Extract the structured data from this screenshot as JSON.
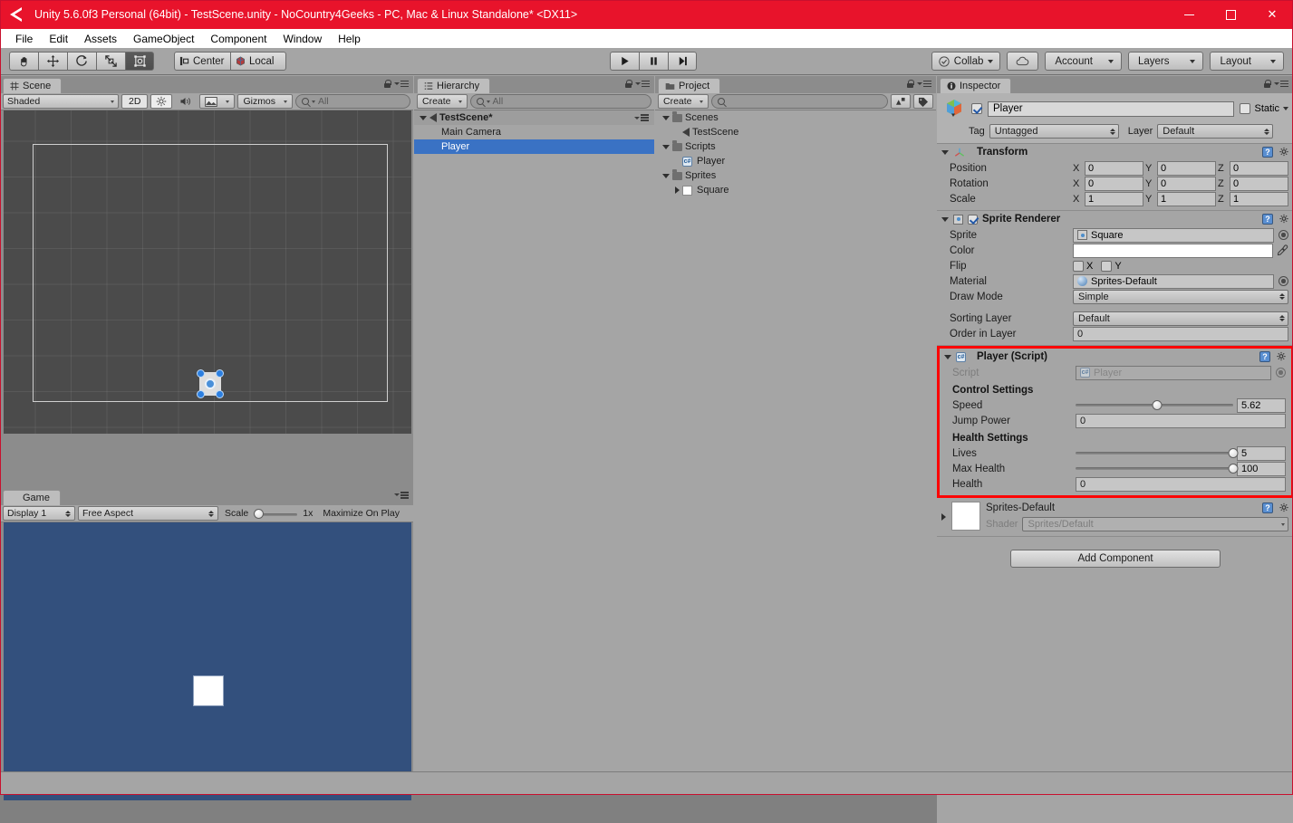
{
  "window": {
    "title": "Unity 5.6.0f3 Personal (64bit) - TestScene.unity - NoCountry4Geeks - PC, Mac & Linux Standalone* <DX11>",
    "title_icon": "unity-logo-icon",
    "minimize": "—",
    "maximize": "□",
    "close": "✕",
    "titlebar_color": "#e8132b"
  },
  "menu": {
    "items": [
      "File",
      "Edit",
      "Assets",
      "GameObject",
      "Component",
      "Window",
      "Help"
    ]
  },
  "toolbar": {
    "tools": [
      {
        "name": "hand-tool",
        "icon": "hand-icon",
        "active": false
      },
      {
        "name": "move-tool",
        "icon": "move-arrows-icon",
        "active": false
      },
      {
        "name": "rotate-tool",
        "icon": "rotate-icon",
        "active": false
      },
      {
        "name": "scale-tool",
        "icon": "scale-icon",
        "active": false
      },
      {
        "name": "rect-tool",
        "icon": "rect-transform-icon",
        "active": true
      }
    ],
    "pivot_mode": "Center",
    "pivot_rotation": "Local",
    "play": "play-icon",
    "pause": "pause-icon",
    "step": "step-icon",
    "collab": "Collab",
    "cloud": "cloud-icon",
    "account": "Account",
    "layers": "Layers",
    "layout": "Layout"
  },
  "scene_panel": {
    "tab": "Scene",
    "tab_icon": "scene-grid-icon",
    "shading_mode": "Shaded",
    "mode_2d": "2D",
    "lighting_icon": "sun-icon",
    "audio_icon": "speaker-icon",
    "effects_icon": "image-icon",
    "gizmos": "Gizmos",
    "search_placeholder": "All"
  },
  "game_panel": {
    "tab": "Game",
    "tab_icon": "game-controller-icon",
    "display": "Display 1",
    "aspect": "Free Aspect",
    "scale_label": "Scale",
    "scale_value": "1x",
    "maximize_on_play": "Maximize On Play",
    "background_color": "#33507d"
  },
  "hierarchy_panel": {
    "tab": "Hierarchy",
    "tab_icon": "hierarchy-list-icon",
    "create_button": "Create",
    "search_placeholder": "All",
    "items": [
      {
        "label": "TestScene*",
        "icon": "unity-scene-icon",
        "depth": 0,
        "expanded": true,
        "selected": false
      },
      {
        "label": "Main Camera",
        "icon": "",
        "depth": 1,
        "expanded": false,
        "selected": false
      },
      {
        "label": "Player",
        "icon": "",
        "depth": 1,
        "expanded": false,
        "selected": true
      }
    ]
  },
  "project_panel": {
    "tab": "Project",
    "tab_icon": "folder-icon",
    "create_button": "Create",
    "search_placeholder": "",
    "items": [
      {
        "label": "Scenes",
        "icon": "folder-icon",
        "depth": 0,
        "arrow": "open"
      },
      {
        "label": "TestScene",
        "icon": "unity-scene-icon",
        "depth": 1,
        "arrow": "none"
      },
      {
        "label": "Scripts",
        "icon": "folder-icon",
        "depth": 0,
        "arrow": "open"
      },
      {
        "label": "Player",
        "icon": "csharp-script-icon",
        "depth": 1,
        "arrow": "none"
      },
      {
        "label": "Sprites",
        "icon": "folder-icon",
        "depth": 0,
        "arrow": "open"
      },
      {
        "label": "Square",
        "icon": "white-sprite-icon",
        "depth": 1,
        "arrow": "closed"
      }
    ]
  },
  "inspector": {
    "tab": "Inspector",
    "tab_icon": "info-icon",
    "object": {
      "icon": "gameobject-cube-icon",
      "enabled": true,
      "name": "Player",
      "static_label": "Static",
      "static_checked": false,
      "tag_label": "Tag",
      "tag_value": "Untagged",
      "layer_label": "Layer",
      "layer_value": "Default"
    },
    "transform": {
      "title": "Transform",
      "icon": "transform-axis-icon",
      "rows": [
        {
          "label": "Position",
          "x": "0",
          "y": "0",
          "z": "0"
        },
        {
          "label": "Rotation",
          "x": "0",
          "y": "0",
          "z": "0"
        },
        {
          "label": "Scale",
          "x": "1",
          "y": "1",
          "z": "1"
        }
      ]
    },
    "sprite_renderer": {
      "title": "Sprite Renderer",
      "icon": "sprite-renderer-icon",
      "enabled": true,
      "sprite_label": "Sprite",
      "sprite_value": "Square",
      "color_label": "Color",
      "color_value": "#ffffff",
      "flip_label": "Flip",
      "flip_x_label": "X",
      "flip_y_label": "Y",
      "flip_x": false,
      "flip_y": false,
      "material_label": "Material",
      "material_value": "Sprites-Default",
      "draw_mode_label": "Draw Mode",
      "draw_mode_value": "Simple",
      "sorting_layer_label": "Sorting Layer",
      "sorting_layer_value": "Default",
      "order_in_layer_label": "Order in Layer",
      "order_in_layer_value": "0"
    },
    "player_script": {
      "title": "Player (Script)",
      "icon": "csharp-script-icon",
      "highlight_color": "#fc0404",
      "script_label": "Script",
      "script_value": "Player",
      "control_settings_header": "Control Settings",
      "speed_label": "Speed",
      "speed_value": "5.62",
      "speed_percent": 52,
      "jump_power_label": "Jump Power",
      "jump_power_value": "0",
      "health_settings_header": "Health Settings",
      "lives_label": "Lives",
      "lives_value": "5",
      "lives_percent": 100,
      "max_health_label": "Max Health",
      "max_health_value": "100",
      "max_health_percent": 100,
      "health_label": "Health",
      "health_value": "0"
    },
    "material": {
      "title": "Sprites-Default",
      "shader_label": "Shader",
      "shader_value": "Sprites/Default"
    },
    "add_component": "Add Component"
  }
}
